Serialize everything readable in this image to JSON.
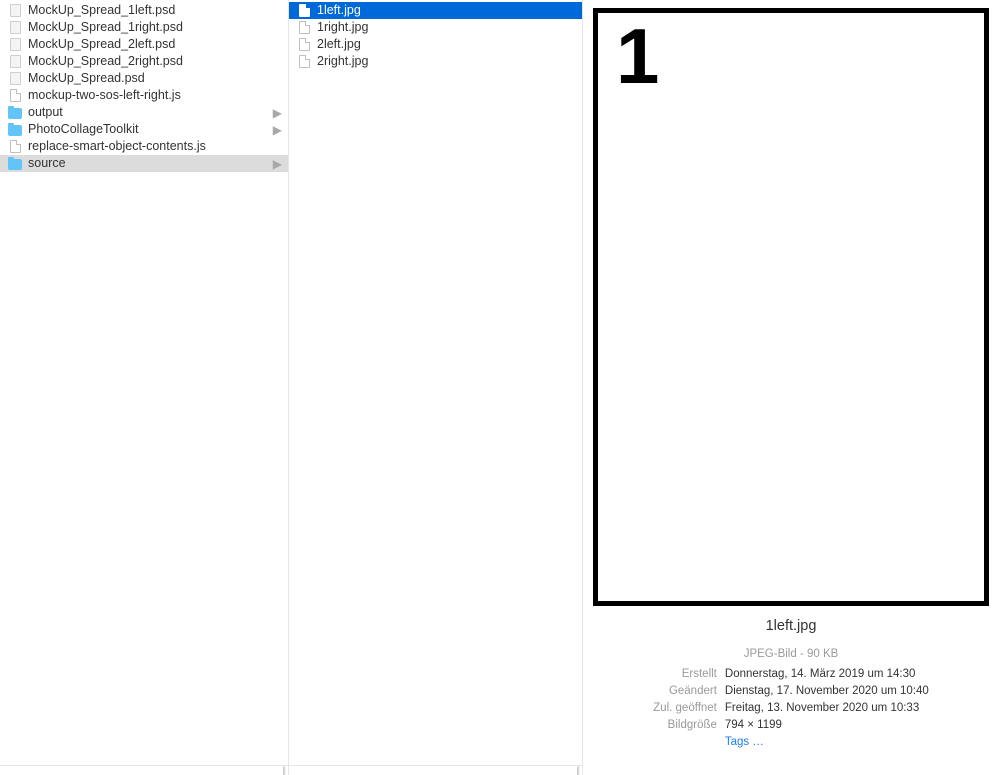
{
  "column1": {
    "items": [
      {
        "name": "MockUp_Spread_1left.psd",
        "icon": "psd",
        "hasChildren": false
      },
      {
        "name": "MockUp_Spread_1right.psd",
        "icon": "psd",
        "hasChildren": false
      },
      {
        "name": "MockUp_Spread_2left.psd",
        "icon": "psd",
        "hasChildren": false
      },
      {
        "name": "MockUp_Spread_2right.psd",
        "icon": "psd",
        "hasChildren": false
      },
      {
        "name": "MockUp_Spread.psd",
        "icon": "psd",
        "hasChildren": false
      },
      {
        "name": "mockup-two-sos-left-right.js",
        "icon": "file",
        "hasChildren": false
      },
      {
        "name": "output",
        "icon": "folder",
        "hasChildren": true
      },
      {
        "name": "PhotoCollageToolkit",
        "icon": "folder",
        "hasChildren": true
      },
      {
        "name": "replace-smart-object-contents.js",
        "icon": "file",
        "hasChildren": false
      },
      {
        "name": "source",
        "icon": "folder",
        "hasChildren": true,
        "selected": "grey"
      }
    ]
  },
  "column2": {
    "items": [
      {
        "name": "1left.jpg",
        "icon": "file",
        "selected": "blue"
      },
      {
        "name": "1right.jpg",
        "icon": "file"
      },
      {
        "name": "2left.jpg",
        "icon": "file"
      },
      {
        "name": "2right.jpg",
        "icon": "file"
      }
    ]
  },
  "preview": {
    "number": "1",
    "filename": "1left.jpg",
    "typeLine": "JPEG-Bild - 90 KB",
    "rows": [
      {
        "key": "Erstellt",
        "val": "Donnerstag, 14. März 2019 um 14:30"
      },
      {
        "key": "Geändert",
        "val": "Dienstag, 17. November 2020 um 10:40"
      },
      {
        "key": "Zul. geöffnet",
        "val": "Freitag, 13. November 2020 um 10:33"
      },
      {
        "key": "Bildgröße",
        "val": "794 × 1199"
      }
    ],
    "tagsLabel": "Tags …"
  }
}
